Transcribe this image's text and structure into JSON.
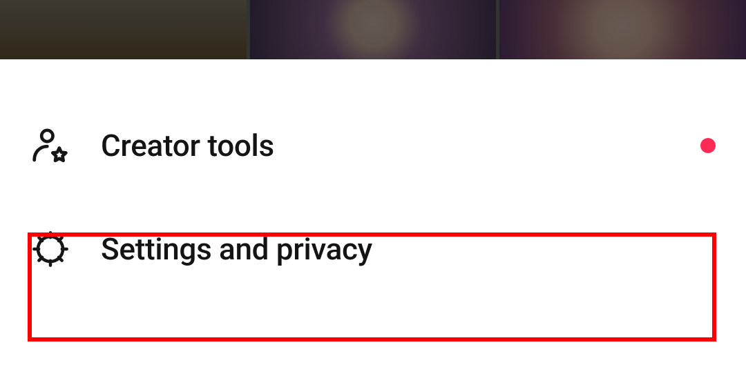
{
  "menu": {
    "items": [
      {
        "label": "Creator tools",
        "hasNotification": true
      },
      {
        "label": "Settings and privacy",
        "hasNotification": false
      }
    ]
  },
  "colors": {
    "accent": "#fe2c55",
    "highlight": "#ff0000"
  }
}
